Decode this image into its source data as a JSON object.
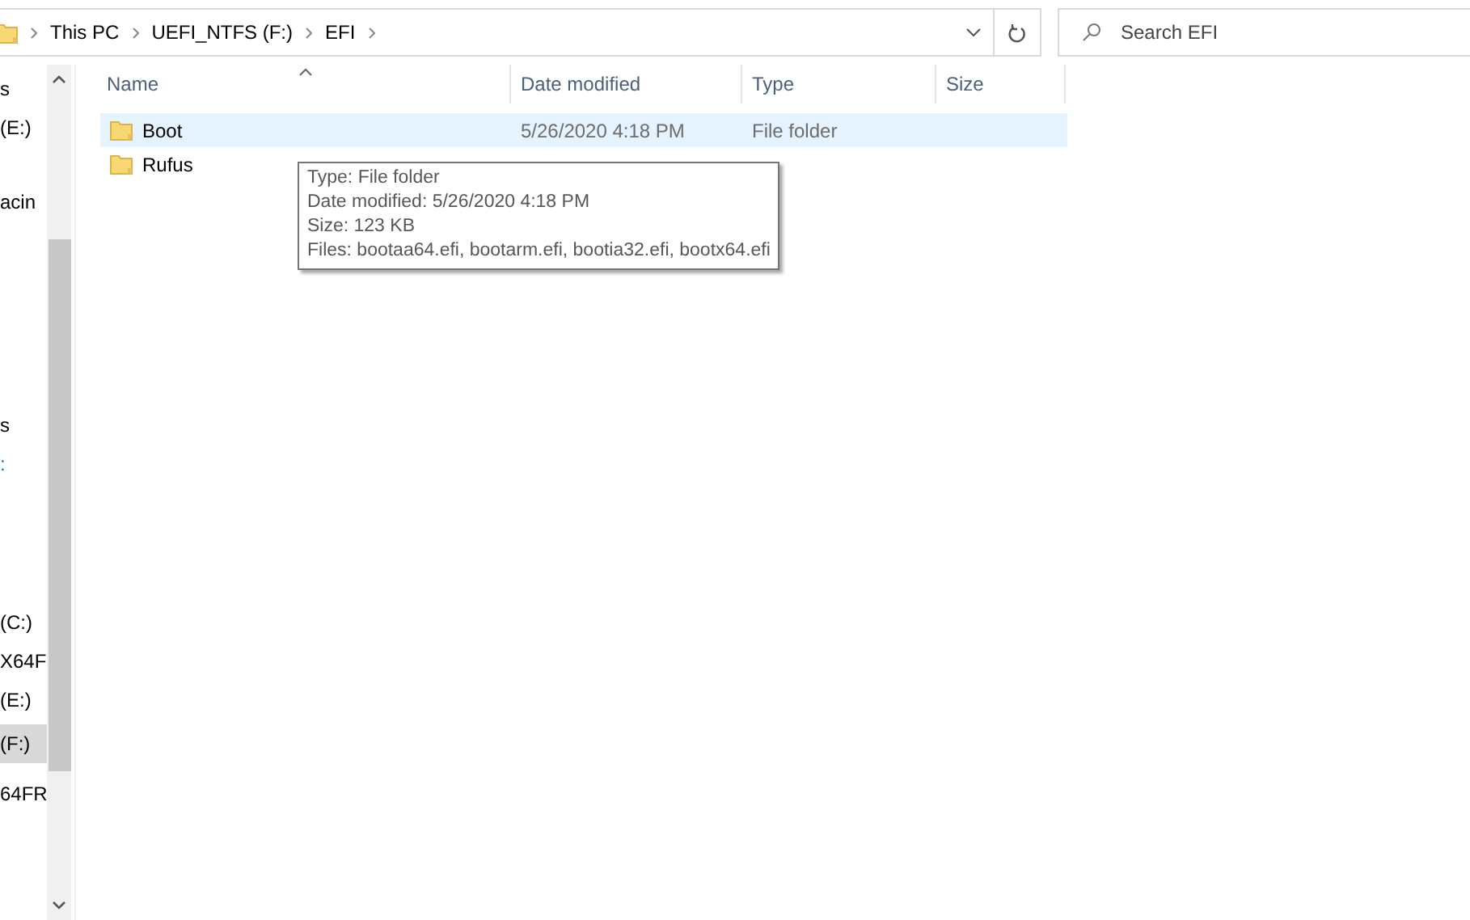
{
  "address_bar": {
    "crumbs": [
      "This PC",
      "UEFI_NTFS (F:)",
      "EFI"
    ]
  },
  "search": {
    "placeholder": "Search EFI"
  },
  "sidebar": {
    "items": [
      {
        "label": "s",
        "selected": false
      },
      {
        "label": "(E:)",
        "selected": false
      },
      {
        "label": "acin",
        "selected": false
      },
      {
        "label": "s",
        "selected": false
      },
      {
        "label": ":",
        "selected": false,
        "color": "#0078d7"
      },
      {
        "label": "(C:)",
        "selected": false
      },
      {
        "label": "X64F",
        "selected": false
      },
      {
        "label": "(E:)",
        "selected": false
      },
      {
        "label": "(F:)",
        "selected": true
      },
      {
        "label": "64FR",
        "selected": false
      }
    ]
  },
  "table": {
    "columns": [
      "Name",
      "Date modified",
      "Type",
      "Size"
    ],
    "rows": [
      {
        "name": "Boot",
        "date": "5/26/2020 4:18 PM",
        "type": "File folder",
        "selected": true
      },
      {
        "name": "Rufus",
        "selected": false
      }
    ]
  },
  "tooltip": {
    "lines": [
      "Type: File folder",
      "Date modified: 5/26/2020 4:18 PM",
      "Size: 123 KB",
      "Files: bootaa64.efi, bootarm.efi, bootia32.efi, bootx64.efi"
    ]
  }
}
